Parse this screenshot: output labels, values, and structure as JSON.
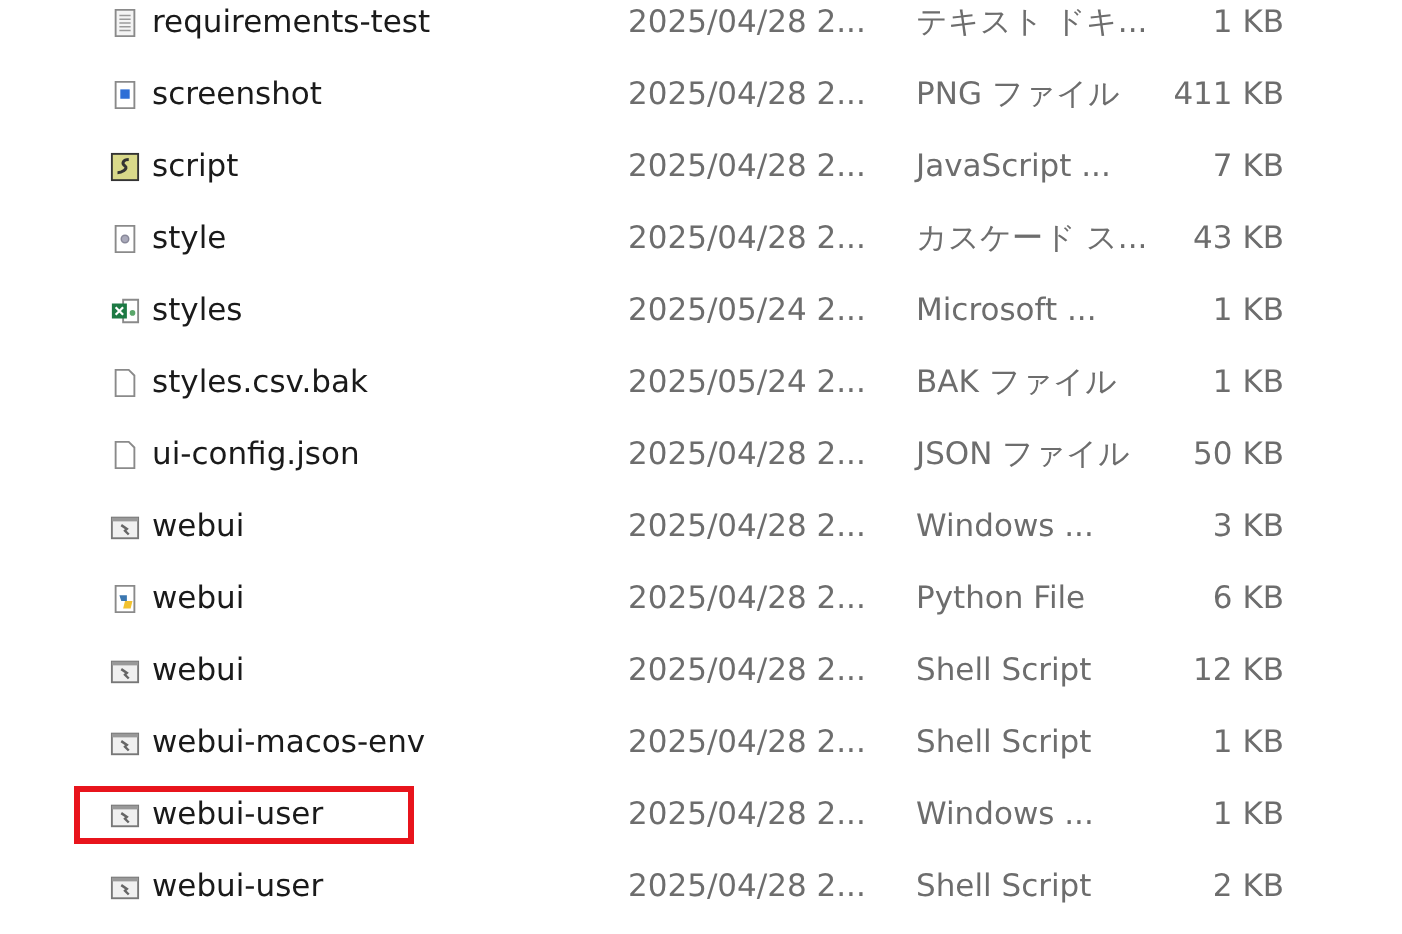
{
  "files": [
    {
      "name": "requirements-test",
      "kind": "text",
      "modified": "2025/04/28 2...",
      "type": "テキスト ドキ...",
      "size": "1 KB",
      "highlighted": false
    },
    {
      "name": "screenshot",
      "kind": "image",
      "modified": "2025/04/28 2...",
      "type": "PNG ファイル",
      "size": "411 KB",
      "highlighted": false
    },
    {
      "name": "script",
      "kind": "javascript",
      "modified": "2025/04/28 2...",
      "type": "JavaScript ...",
      "size": "7 KB",
      "highlighted": false
    },
    {
      "name": "style",
      "kind": "stylesheet",
      "modified": "2025/04/28 2...",
      "type": "カスケード ス...",
      "size": "43 KB",
      "highlighted": false
    },
    {
      "name": "styles",
      "kind": "spreadsheet",
      "modified": "2025/05/24 2...",
      "type": "Microsoft ...",
      "size": "1 KB",
      "highlighted": false
    },
    {
      "name": "styles.csv.bak",
      "kind": "blank",
      "modified": "2025/05/24 2...",
      "type": "BAK ファイル",
      "size": "1 KB",
      "highlighted": false
    },
    {
      "name": "ui-config.json",
      "kind": "blank",
      "modified": "2025/04/28 2...",
      "type": "JSON ファイル",
      "size": "50 KB",
      "highlighted": false
    },
    {
      "name": "webui",
      "kind": "shell",
      "modified": "2025/04/28 2...",
      "type": "Windows ...",
      "size": "3 KB",
      "highlighted": false
    },
    {
      "name": "webui",
      "kind": "python",
      "modified": "2025/04/28 2...",
      "type": "Python File",
      "size": "6 KB",
      "highlighted": false
    },
    {
      "name": "webui",
      "kind": "shell",
      "modified": "2025/04/28 2...",
      "type": "Shell Script",
      "size": "12 KB",
      "highlighted": false
    },
    {
      "name": "webui-macos-env",
      "kind": "shell",
      "modified": "2025/04/28 2...",
      "type": "Shell Script",
      "size": "1 KB",
      "highlighted": false
    },
    {
      "name": "webui-user",
      "kind": "shell",
      "modified": "2025/04/28 2...",
      "type": "Windows ...",
      "size": "1 KB",
      "highlighted": true
    },
    {
      "name": "webui-user",
      "kind": "shell",
      "modified": "2025/04/28 2...",
      "type": "Shell Script",
      "size": "2 KB",
      "highlighted": false
    }
  ]
}
